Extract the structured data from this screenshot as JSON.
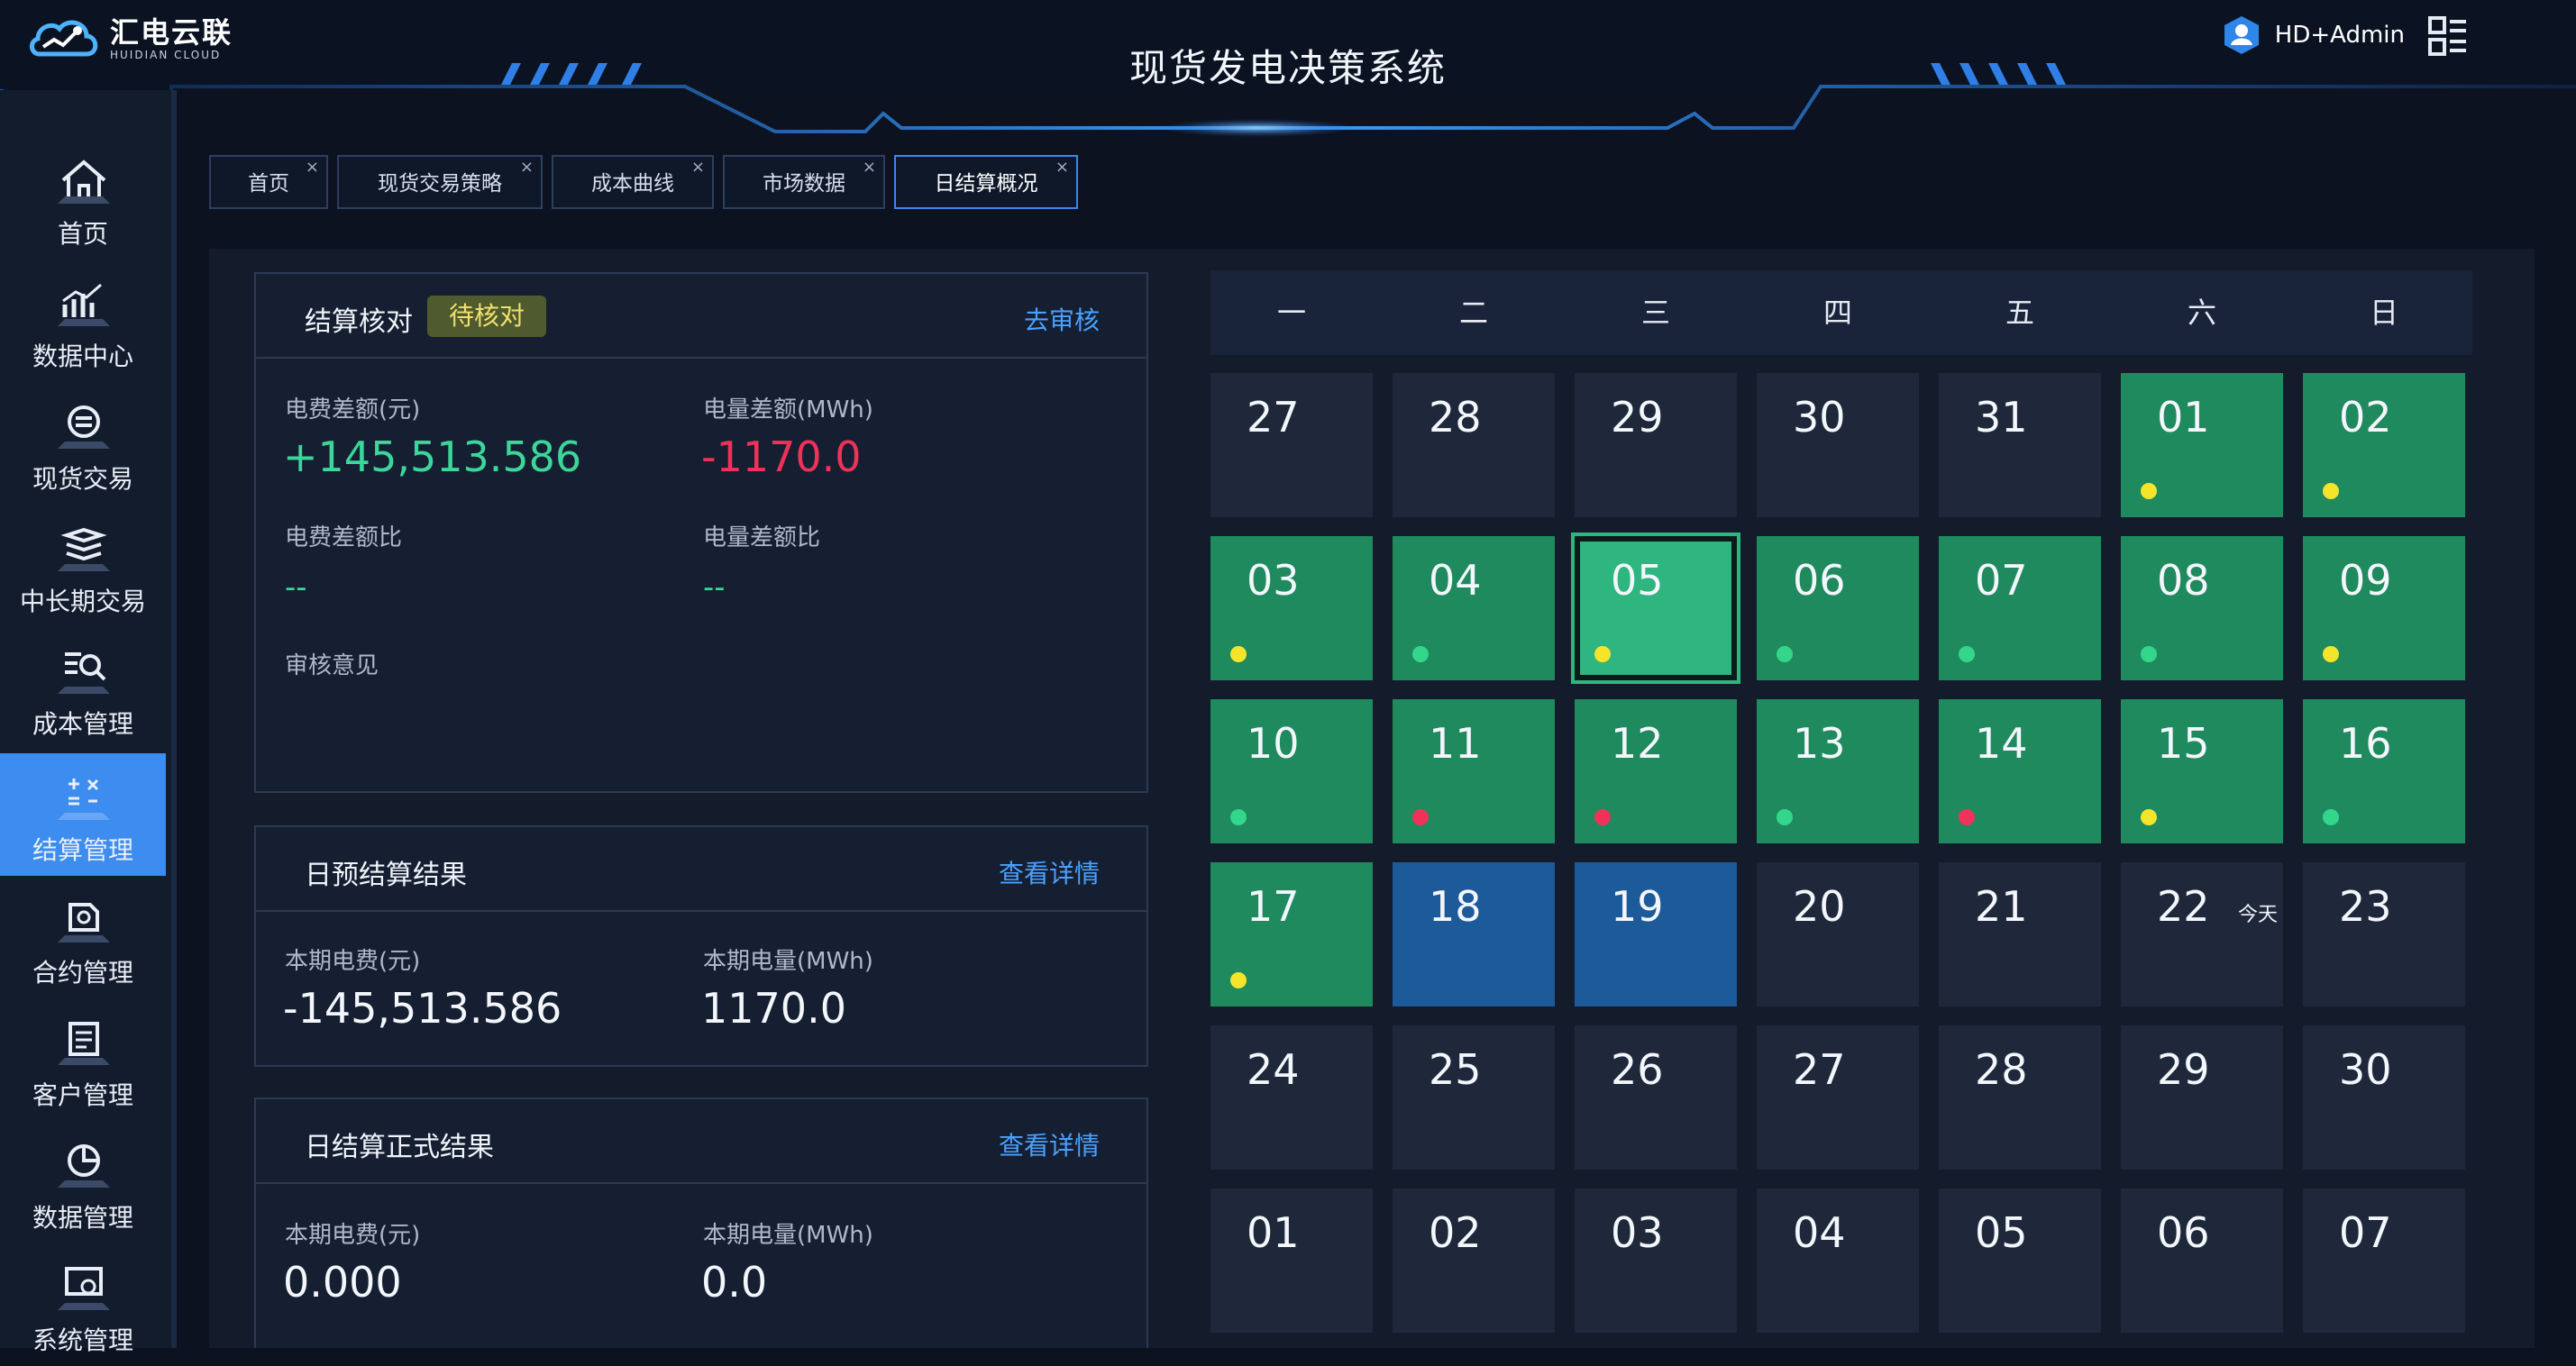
{
  "brand": {
    "name": "汇电云联",
    "sub": "HUIDIAN CLOUD"
  },
  "system_title": "现货发电决策系统",
  "user": {
    "name": "HD+Admin"
  },
  "icons": {
    "logo": "cloud-logo-icon",
    "user": "user-avatar-icon",
    "menu": "grid-menu-icon"
  },
  "sidebar": {
    "items": [
      {
        "label": "首页",
        "icon": "home-icon"
      },
      {
        "label": "数据中心",
        "icon": "chart-icon"
      },
      {
        "label": "现货交易",
        "icon": "exchange-icon"
      },
      {
        "label": "中长期交易",
        "icon": "stack-icon"
      },
      {
        "label": "成本管理",
        "icon": "search-list-icon"
      },
      {
        "label": "结算管理",
        "icon": "calculator-icon",
        "active": true
      },
      {
        "label": "合约管理",
        "icon": "contract-icon"
      },
      {
        "label": "客户管理",
        "icon": "customer-icon"
      },
      {
        "label": "数据管理",
        "icon": "pie-icon"
      },
      {
        "label": "系统管理",
        "icon": "settings-icon"
      }
    ]
  },
  "tabs": [
    {
      "label": "首页",
      "close": "×"
    },
    {
      "label": "现货交易策略",
      "close": "×"
    },
    {
      "label": "成本曲线",
      "close": "×"
    },
    {
      "label": "市场数据",
      "close": "×"
    },
    {
      "label": "日结算概况",
      "close": "×",
      "active": true
    }
  ],
  "check_card": {
    "title": "结算核对",
    "badge": "待核对",
    "link": "去审核",
    "fee_diff_label": "电费差额(元)",
    "fee_diff_value": "+145,513.586",
    "energy_diff_label": "电量差额(MWh)",
    "energy_diff_value": "-1170.0",
    "fee_ratio_label": "电费差额比",
    "fee_ratio_value": "--",
    "energy_ratio_label": "电量差额比",
    "energy_ratio_value": "--",
    "review_label": "审核意见"
  },
  "pre_card": {
    "title": "日预结算结果",
    "link": "查看详情",
    "fee_label": "本期电费(元)",
    "fee_value": "-145,513.586",
    "energy_label": "本期电量(MWh)",
    "energy_value": "1170.0"
  },
  "formal_card": {
    "title": "日结算正式结果",
    "link": "查看详情",
    "fee_label": "本期电费(元)",
    "fee_value": "0.000",
    "energy_label": "本期电量(MWh)",
    "energy_value": "0.0"
  },
  "calendar": {
    "weekdays": [
      "一",
      "二",
      "三",
      "四",
      "五",
      "六",
      "日"
    ],
    "today_label": "今天",
    "colors": {
      "green": "#1f8a5e",
      "selected": "#2fb57f",
      "blue": "#1d5a99",
      "empty": "#1e283a",
      "dot_yellow": "#f5e52a",
      "dot_green": "#33d68b",
      "dot_red": "#f0325b"
    },
    "days": [
      {
        "n": "27",
        "s": "empty"
      },
      {
        "n": "28",
        "s": "empty"
      },
      {
        "n": "29",
        "s": "empty"
      },
      {
        "n": "30",
        "s": "empty"
      },
      {
        "n": "31",
        "s": "empty"
      },
      {
        "n": "01",
        "s": "green",
        "dot": "yellow"
      },
      {
        "n": "02",
        "s": "green",
        "dot": "yellow"
      },
      {
        "n": "03",
        "s": "green",
        "dot": "yellow"
      },
      {
        "n": "04",
        "s": "green",
        "dot": "green"
      },
      {
        "n": "05",
        "s": "selected",
        "dot": "yellow"
      },
      {
        "n": "06",
        "s": "green",
        "dot": "green"
      },
      {
        "n": "07",
        "s": "green",
        "dot": "green"
      },
      {
        "n": "08",
        "s": "green",
        "dot": "green"
      },
      {
        "n": "09",
        "s": "green",
        "dot": "yellow"
      },
      {
        "n": "10",
        "s": "green",
        "dot": "green"
      },
      {
        "n": "11",
        "s": "green",
        "dot": "red"
      },
      {
        "n": "12",
        "s": "green",
        "dot": "red"
      },
      {
        "n": "13",
        "s": "green",
        "dot": "green"
      },
      {
        "n": "14",
        "s": "green",
        "dot": "red"
      },
      {
        "n": "15",
        "s": "green",
        "dot": "yellow"
      },
      {
        "n": "16",
        "s": "green",
        "dot": "green"
      },
      {
        "n": "17",
        "s": "green",
        "dot": "yellow"
      },
      {
        "n": "18",
        "s": "blue"
      },
      {
        "n": "19",
        "s": "blue"
      },
      {
        "n": "20",
        "s": "empty"
      },
      {
        "n": "21",
        "s": "empty"
      },
      {
        "n": "22",
        "s": "empty",
        "today": true
      },
      {
        "n": "23",
        "s": "empty"
      },
      {
        "n": "24",
        "s": "empty"
      },
      {
        "n": "25",
        "s": "empty"
      },
      {
        "n": "26",
        "s": "empty"
      },
      {
        "n": "27",
        "s": "empty"
      },
      {
        "n": "28",
        "s": "empty"
      },
      {
        "n": "29",
        "s": "empty"
      },
      {
        "n": "30",
        "s": "empty"
      },
      {
        "n": "01",
        "s": "empty"
      },
      {
        "n": "02",
        "s": "empty"
      },
      {
        "n": "03",
        "s": "empty"
      },
      {
        "n": "04",
        "s": "empty"
      },
      {
        "n": "05",
        "s": "empty"
      },
      {
        "n": "06",
        "s": "empty"
      },
      {
        "n": "07",
        "s": "empty"
      }
    ]
  }
}
